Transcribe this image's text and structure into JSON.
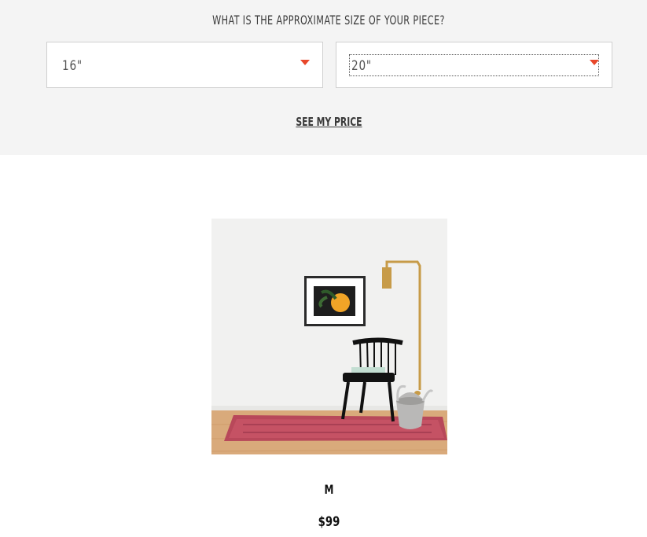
{
  "size_selector": {
    "question": "WHAT IS THE APPROXIMATE SIZE OF YOUR PIECE?",
    "width_value": "16\"",
    "height_value": "20\"",
    "accent_color": "#e8472a",
    "caret_icon": "caret-down-icon"
  },
  "actions": {
    "see_price_label": "SEE MY PRICE"
  },
  "product": {
    "size_label": "M",
    "price": "$99"
  }
}
